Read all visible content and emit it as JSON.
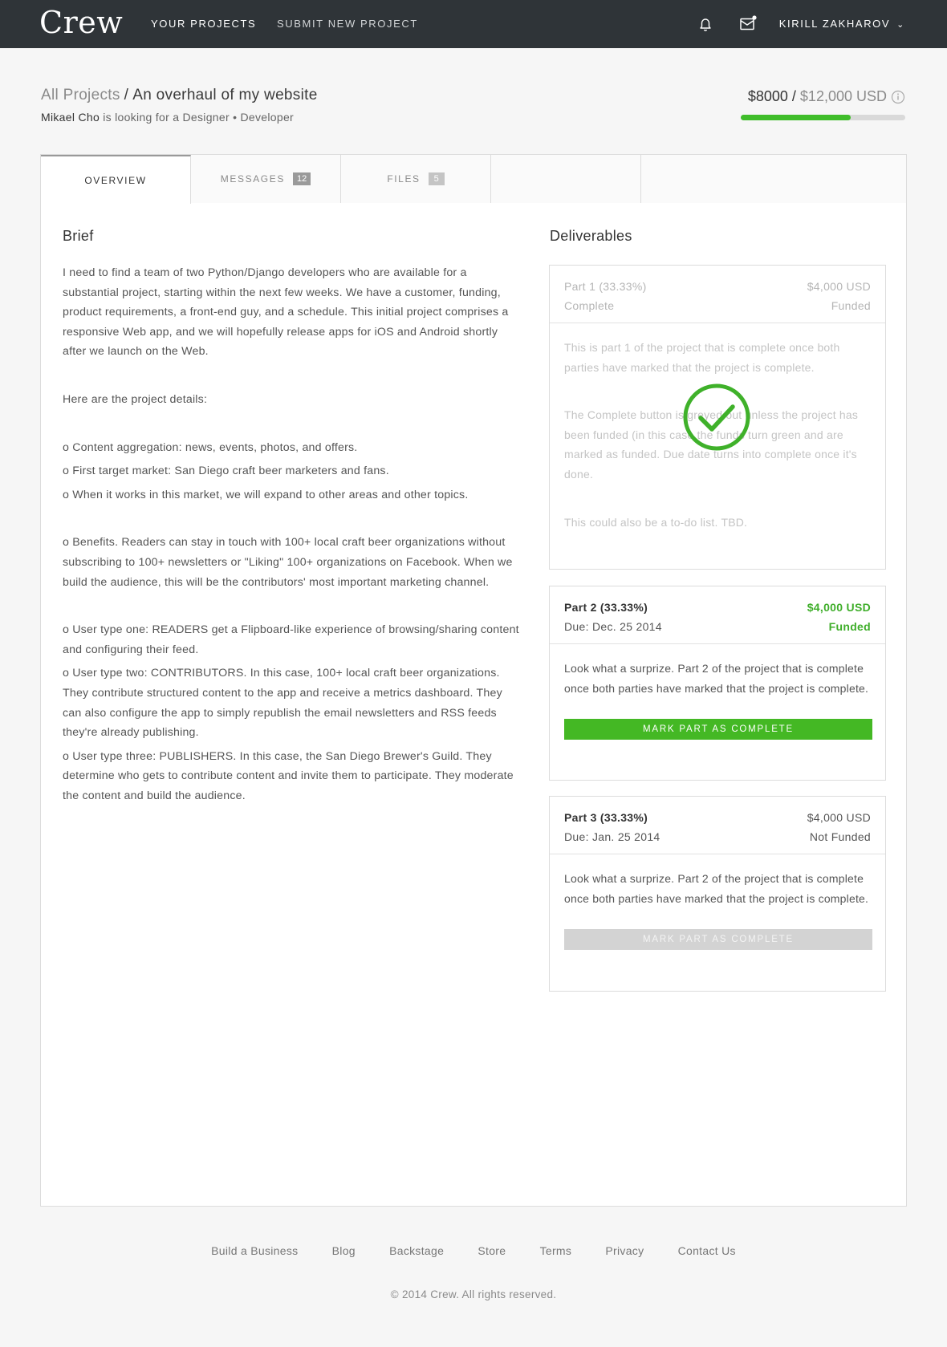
{
  "nav": {
    "logo": "Crew",
    "links": [
      "YOUR PROJECTS",
      "SUBMIT NEW PROJECT"
    ],
    "user": "KIRILL ZAKHAROV"
  },
  "header": {
    "crumb_root": "All Projects",
    "crumb_sep": "/",
    "title": "An overhaul of my website",
    "client": "Mikael Cho",
    "looking": "is looking for a Designer • Developer",
    "budget_funded": "$8000",
    "budget_sep": "/",
    "budget_total": "$12,000 USD",
    "funded_fraction": 0.6667
  },
  "tabs": [
    {
      "label": "OVERVIEW"
    },
    {
      "label": "MESSAGES",
      "badge": "12"
    },
    {
      "label": "FILES",
      "badge": "5"
    }
  ],
  "brief": {
    "title": "Brief",
    "paragraphs": [
      "I need to find a team of two Python/Django developers who are available for a substantial project, starting within the next few weeks. We have a customer, funding, product requirements, a front-end guy, and a schedule. This initial project comprises a responsive Web app, and we will hopefully release apps for iOS and Android shortly after we launch on the Web.",
      "Here are the project details:",
      "o Content aggregation: news, events, photos, and offers.",
      "o First target market: San Diego craft beer marketers and fans.",
      "o When it works in this market, we will expand to other areas and other topics.",
      "o Benefits. Readers can stay in touch with 100+ local craft beer organizations without subscribing to 100+ newsletters or \"Liking\" 100+ organizations on Facebook. When we build the audience, this will be the contributors' most important marketing channel.",
      "o User type one: READERS get a Flipboard-like experience of browsing/sharing content and configuring their feed.",
      "o User type two: CONTRIBUTORS. In this case, 100+ local craft beer organizations. They contribute structured content to the app and receive a metrics dashboard. They can also configure the app to simply republish the email newsletters and RSS feeds they're already publishing.",
      "o User type three: PUBLISHERS. In this case, the San Diego Brewer's Guild. They determine who gets to contribute content and invite them to participate. They moderate the content and build the audience."
    ]
  },
  "deliverables": {
    "title": "Deliverables",
    "parts": [
      {
        "name": "Part 1 (33.33%)",
        "status": "Complete",
        "amount": "$4,000 USD",
        "funding": "Funded",
        "body": [
          "This is part 1 of the project that is complete once both parties have marked that the project is complete.",
          "The Complete button is greyed out unless the project has been funded (in this case the funds turn green and are marked as funded. Due date turns into complete once it's done.",
          "This could also be a to-do list. TBD."
        ]
      },
      {
        "name": "Part 2 (33.33%)",
        "status": "Due: Dec. 25 2014",
        "amount": "$4,000 USD",
        "funding": "Funded",
        "body": [
          "Look what a surprize. Part 2 of the project that is complete once both parties have marked that the project is complete."
        ],
        "button": "MARK PART AS COMPLETE"
      },
      {
        "name": "Part 3 (33.33%)",
        "status": "Due: Jan. 25 2014",
        "amount": "$4,000 USD",
        "funding": "Not Funded",
        "body": [
          "Look what a surprize. Part 2 of the project that is complete once both parties have marked that the project is complete."
        ],
        "button": "MARK PART AS COMPLETE"
      }
    ]
  },
  "footer": {
    "links": [
      "Build a Business",
      "Blog",
      "Backstage",
      "Store",
      "Terms",
      "Privacy",
      "Contact Us"
    ],
    "copyright": "© 2014 Crew. All rights reserved."
  },
  "colors": {
    "nav_bg": "#2f3438",
    "accent_green": "#44b824",
    "funded_green": "#3fae2a",
    "page_bg": "#f6f6f6"
  }
}
